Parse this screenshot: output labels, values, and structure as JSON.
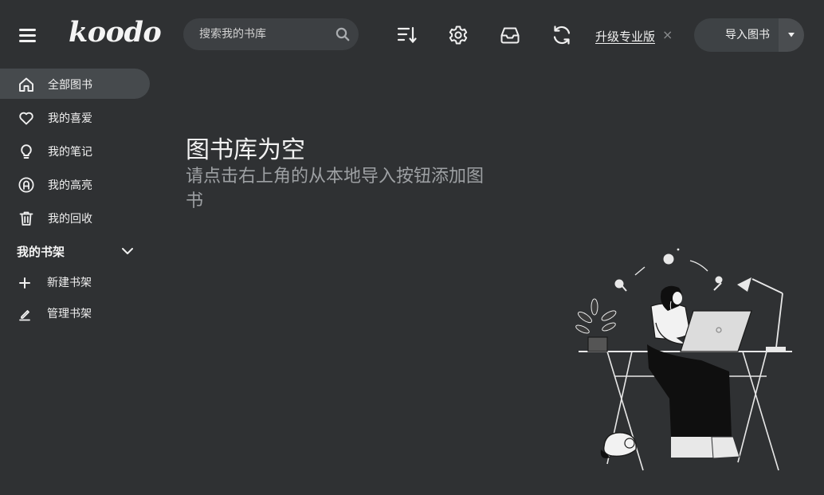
{
  "app": {
    "logo": "koodo"
  },
  "search": {
    "placeholder": "搜索我的书库"
  },
  "toolbar": {
    "icons": [
      "sort-icon",
      "settings-gear-icon",
      "inbox-icon",
      "sync-icon"
    ],
    "upgrade_label": "升级专业版",
    "upgrade_close": "×",
    "import_label": "导入图书"
  },
  "sidebar": {
    "items": [
      {
        "label": "全部图书",
        "icon": "home-icon",
        "active": true
      },
      {
        "label": "我的喜爱",
        "icon": "heart-icon",
        "active": false
      },
      {
        "label": "我的笔记",
        "icon": "lightbulb-icon",
        "active": false
      },
      {
        "label": "我的高亮",
        "icon": "highlight-icon",
        "active": false
      },
      {
        "label": "我的回收",
        "icon": "trash-icon",
        "active": false
      }
    ],
    "shelf_header": "我的书架",
    "shelf_items": [
      {
        "label": "新建书架",
        "icon": "plus-icon"
      },
      {
        "label": "管理书架",
        "icon": "pencil-icon"
      }
    ]
  },
  "empty_state": {
    "title": "图书库为空",
    "subtitle": "请点击右上角的从本地导入按钮添加图书"
  },
  "colors": {
    "background": "#2f3133",
    "search_bg": "#3d4043",
    "active_item_bg": "#464a4d",
    "text_primary": "#f0f0f0",
    "text_secondary": "#9da0a3"
  }
}
